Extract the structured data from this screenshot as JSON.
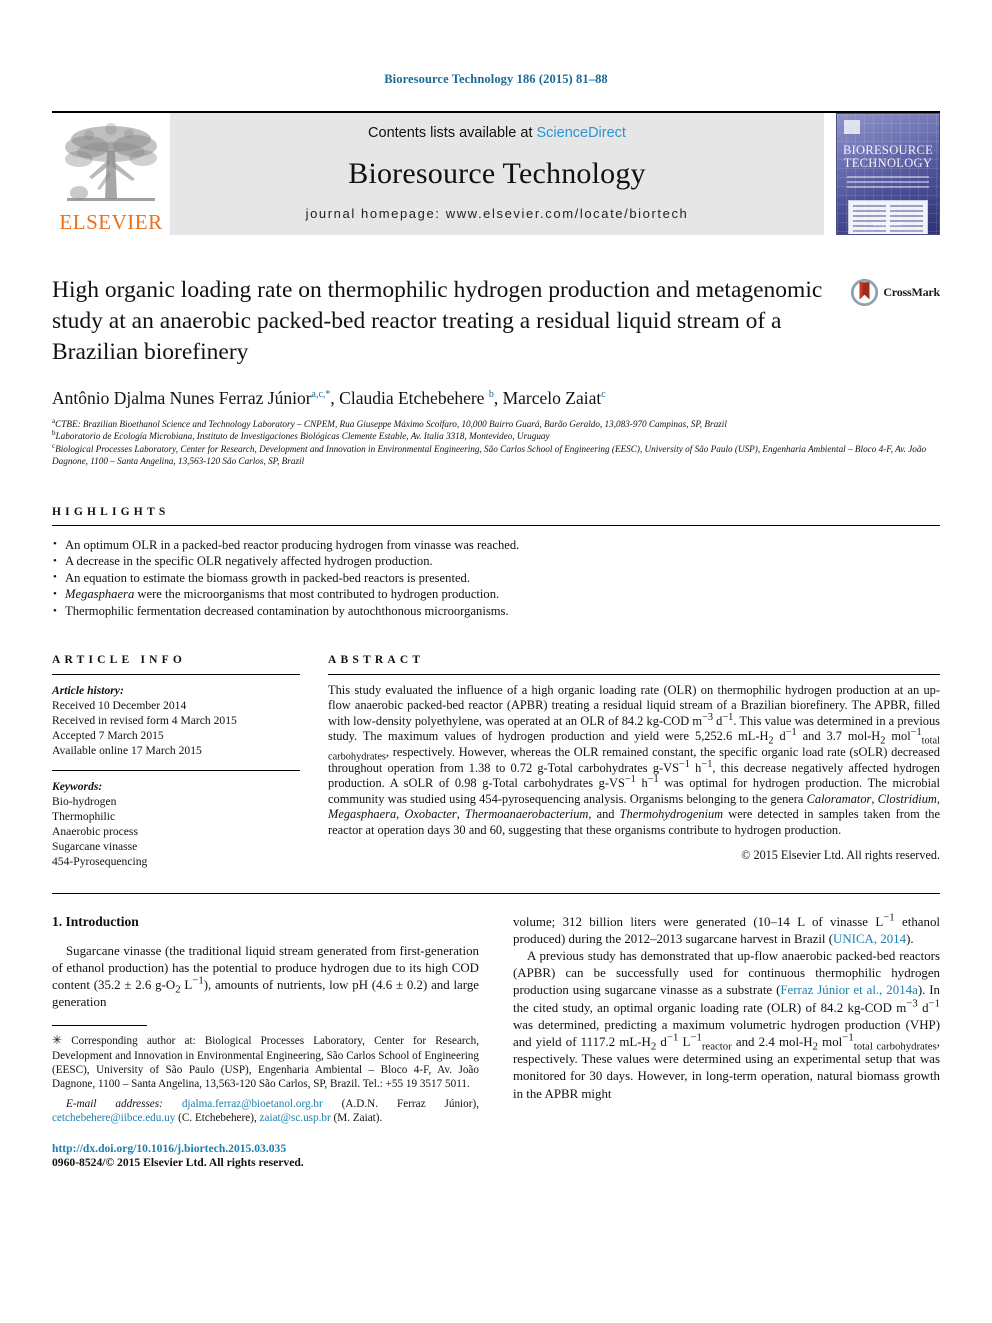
{
  "running_head": "Bioresource Technology 186 (2015) 81–88",
  "masthead": {
    "elsevier_wordmark": "ELSEVIER",
    "contents_prefix": "Contents lists available at ",
    "sciencedirect": "ScienceDirect",
    "journal_name": "Bioresource Technology",
    "journal_homepage": "journal homepage: www.elsevier.com/locate/biortech",
    "cover_title_line1": "BIORESOURCE",
    "cover_title_line2": "TECHNOLOGY"
  },
  "article": {
    "title": "High organic loading rate on thermophilic hydrogen production and metagenomic study at an anaerobic packed-bed reactor treating a residual liquid stream of a Brazilian biorefinery",
    "crossmark_label": "CrossMark",
    "authors_html": "Antônio Djalma Nunes Ferraz Júnior<sup>a,c,*</sup>, Claudia Etchebehere <sup>b</sup>, Marcelo Zaiat<sup>c</sup>",
    "affiliations": [
      "a CTBE: Brazilian Bioethanol Science and Technology Laboratory – CNPEM, Rua Giuseppe Máximo Scolfaro, 10,000 Bairro Guará, Barão Geraldo, 13,083-970 Campinas, SP, Brazil",
      "b Laboratorio de Ecología Microbiana, Instituto de Investigaciones Biológicas Clemente Estable, Av. Italia 3318, Montevideo, Uruguay",
      "c Biological Processes Laboratory, Center for Research, Development and Innovation in Environmental Engineering, São Carlos School of Engineering (EESC), University of São Paulo (USP), Engenharia Ambiental – Bloco 4-F, Av. João Dagnone, 1100 – Santa Angelina, 13,563-120 São Carlos, SP, Brazil"
    ]
  },
  "highlights": {
    "heading": "HIGHLIGHTS",
    "items": [
      "An optimum OLR in a packed-bed reactor producing hydrogen from vinasse was reached.",
      "A decrease in the specific OLR negatively affected hydrogen production.",
      "An equation to estimate the biomass growth in packed-bed reactors is presented.",
      "Megasphaera were the microorganisms that most contributed to hydrogen production.",
      "Thermophilic fermentation decreased contamination by autochthonous microorganisms."
    ],
    "italic_first_word_index": 3
  },
  "article_info": {
    "heading": "ARTICLE INFO",
    "history_label": "Article history:",
    "history": [
      "Received 10 December 2014",
      "Received in revised form 4 March 2015",
      "Accepted 7 March 2015",
      "Available online 17 March 2015"
    ],
    "keywords_label": "Keywords:",
    "keywords": [
      "Bio-hydrogen",
      "Thermophilic",
      "Anaerobic process",
      "Sugarcane vinasse",
      "454-Pyrosequencing"
    ]
  },
  "abstract": {
    "heading": "ABSTRACT",
    "text_html": "This study evaluated the influence of a high organic loading rate (OLR) on thermophilic hydrogen production at an up-flow anaerobic packed-bed reactor (APBR) treating a residual liquid stream of a Brazilian biorefinery. The APBR, filled with low-density polyethylene, was operated at an OLR of 84.2 kg-COD m<sup>−3</sup> d<sup>−1</sup>. This value was determined in a previous study. The maximum values of hydrogen production and yield were 5,252.6 mL-H<sub>2</sub> d<sup>−1</sup> and 3.7 mol-H<sub>2</sub> mol<sup>−1</sup><sub>total carbohydrates</sub>, respectively. However, whereas the OLR remained constant, the specific organic load rate (sOLR) decreased throughout operation from 1.38 to 0.72 g-Total carbohydrates g-VS<sup>−1</sup> h<sup>−1</sup>, this decrease negatively affected hydrogen production. A sOLR of 0.98 g-Total carbohydrates g-VS<sup>−1</sup> h<sup>−1</sup> was optimal for hydrogen production. The microbial community was studied using 454-pyrosequencing analysis. Organisms belonging to the genera <i>Caloramator</i>, <i>Clostridium</i>, <i>Megasphaera</i>, <i>Oxobacter</i>, <i>Thermoanaerobacterium</i>, and <i>Thermohydrogenium</i> were detected in samples taken from the reactor at operation days 30 and 60, suggesting that these organisms contribute to hydrogen production.",
    "copyright": "© 2015 Elsevier Ltd. All rights reserved."
  },
  "introduction": {
    "heading": "1. Introduction",
    "left_para_html": "Sugarcane vinasse (the traditional liquid stream generated from first-generation of ethanol production) has the potential to produce hydrogen due to its high COD content (35.2 ± 2.6 g-O<sub>2</sub> L<sup>−1</sup>), amounts of nutrients, low pH (4.6 ± 0.2) and large generation",
    "right_para1_html": "volume; 312 billion liters were generated (10–14 L of vinasse L<sup>−1</sup> ethanol produced) during the 2012–2013 sugarcane harvest in Brazil (<span class=\"link\">UNICA, 2014</span>).",
    "right_para2_html": "A previous study has demonstrated that up-flow anaerobic packed-bed reactors (APBR) can be successfully used for continuous thermophilic hydrogen production using sugarcane vinasse as a substrate (<span class=\"link\">Ferraz Júnior et al., 2014a</span>). In the cited study, an optimal organic loading rate (OLR) of 84.2 kg-COD m<sup>−3</sup> d<sup>−1</sup> was determined, predicting a maximum volumetric hydrogen production (VHP) and yield of 1117.2 mL-H<sub>2</sub> d<sup>−1</sup> L<sup>−1</sup><sub>reactor</sub> and 2.4 mol-H<sub>2</sub> mol<sup>−1</sup><sub>total carbohydrates</sub>, respectively. These values were determined using an experimental setup that was monitored for 30 days. However, in long-term operation, natural biomass growth in the APBR might"
  },
  "footnote": {
    "corresponding_html": "<span style=\"font-size:12px\">✳</span> Corresponding author at: Biological Processes Laboratory, Center for Research, Development and Innovation in Environmental Engineering, São Carlos School of Engineering (EESC), University of São Paulo (USP), Engenharia Ambiental – Bloco 4-F, Av. João Dagnone, 1100 – Santa Angelina, 13,563-120 São Carlos, SP, Brazil. Tel.: +55 19 3517 5011.",
    "email_html": "<span class=\"ital\">E-mail addresses:</span> <span class=\"link\">djalma.ferraz@bioetanol.org.br</span> (A.D.N. Ferraz Júnior), <span class=\"link\">cetchebehere@iibce.edu.uy</span> (C. Etchebehere), <span class=\"link\">zaiat@sc.usp.br</span> (M. Zaiat)."
  },
  "footer": {
    "doi": "http://dx.doi.org/10.1016/j.biortech.2015.03.035",
    "issn_line": "0960-8524/© 2015 Elsevier Ltd. All rights reserved."
  },
  "colors": {
    "accent_link": "#1a7fb0",
    "running_head": "#1a6a96",
    "elsevier_orange": "#E9711C",
    "sciencedirect_blue": "#2a96d1",
    "band_gray": "#e6e6e6"
  }
}
